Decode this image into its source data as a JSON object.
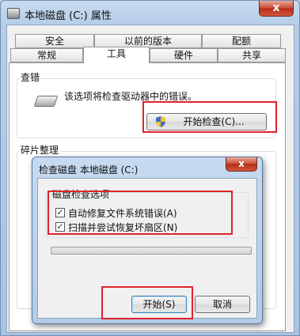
{
  "window": {
    "title": "本地磁盘 (C:) 属性",
    "close": "x"
  },
  "tabs_row1": [
    {
      "label": "安全"
    },
    {
      "label": "以前的版本"
    },
    {
      "label": "配额"
    }
  ],
  "tabs_row2": [
    {
      "label": "常规"
    },
    {
      "label": "工具"
    },
    {
      "label": "硬件"
    },
    {
      "label": "共享"
    }
  ],
  "error_check": {
    "group_label": "查错",
    "description": "该选项将检查驱动器中的错误。",
    "button": "开始检查(C)..."
  },
  "defrag": {
    "group_label": "碎片整理"
  },
  "dialog": {
    "title": "检查磁盘 本地磁盘 (C:)",
    "close": "x",
    "options_label": "磁盘检查选项",
    "option1": "自动修复文件系统错误(A)",
    "option2": "扫描并尝试恢复坏扇区(N)",
    "option1_checked": true,
    "option2_checked": true,
    "progress": 0,
    "start_button": "开始(S)",
    "cancel_button": "取消"
  },
  "colors": {
    "highlight": "#e0232b",
    "title_bar": "#b6cde8"
  }
}
